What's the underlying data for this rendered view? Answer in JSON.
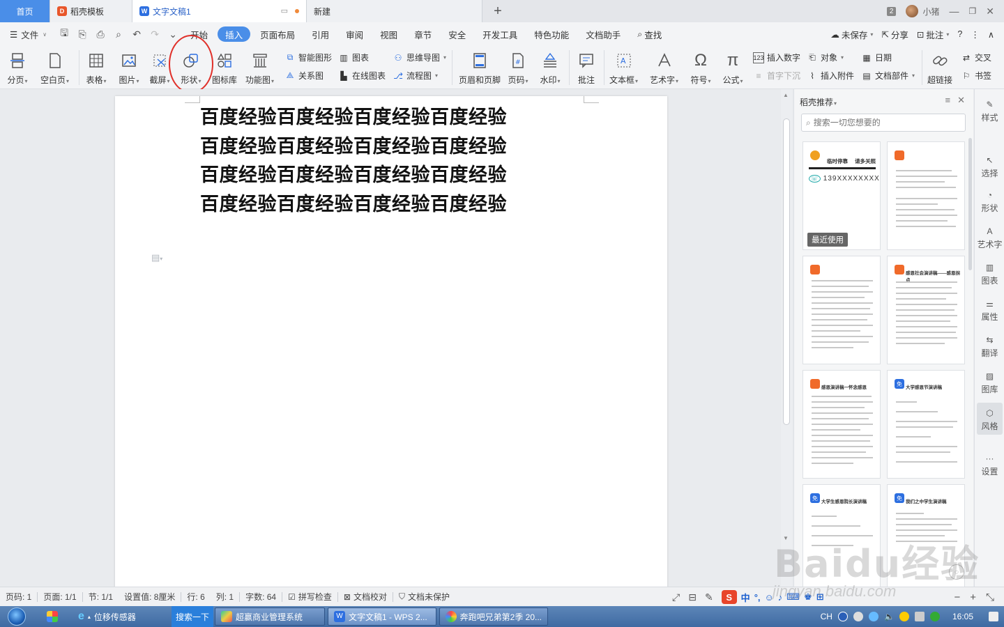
{
  "titlebar": {
    "tabs": [
      {
        "label": "首页"
      },
      {
        "label": "稻壳模板"
      },
      {
        "label": "文字文稿1"
      },
      {
        "label": "新建"
      }
    ],
    "page_number_badge": "2",
    "username": "小猪"
  },
  "menubar": {
    "file_label": "文件",
    "items": [
      "开始",
      "插入",
      "页面布局",
      "引用",
      "审阅",
      "视图",
      "章节",
      "安全",
      "开发工具",
      "特色功能",
      "文档助手"
    ],
    "active_item": "插入",
    "search_label": "查找",
    "unsaved_label": "未保存",
    "share_label": "分享",
    "comment_label": "批注"
  },
  "ribbon": {
    "page_break": "分页",
    "blank_page": "空白页",
    "table": "表格",
    "picture": "图片",
    "screenshot": "截屏",
    "shape": "形状",
    "icon_lib": "图标库",
    "function_chart": "功能图",
    "smart_art": "智能图形",
    "chart": "图表",
    "mind_map": "思维导图",
    "relation": "关系图",
    "online_chart": "在线图表",
    "flowchart": "流程图",
    "header_footer": "页眉和页脚",
    "page_num": "页码",
    "watermark": "水印",
    "comment": "批注",
    "textbox": "文本框",
    "word_art": "艺术字",
    "symbol": "符号",
    "formula": "公式",
    "insert_number": "插入数字",
    "object": "对象",
    "date": "日期",
    "drop_cap": "首字下沉",
    "attachment": "插入附件",
    "doc_parts": "文档部件",
    "hyperlink": "超链接",
    "cross_ref": "交叉",
    "bookmark": "书签"
  },
  "document": {
    "lines": [
      "百度经验百度经验百度经验百度经验",
      "百度经验百度经验百度经验百度经验",
      "百度经验百度经验百度经验百度经验",
      "百度经验百度经验百度经验百度经验"
    ]
  },
  "panel": {
    "title": "稻壳推荐",
    "search_placeholder": "搜索一切您想要的",
    "recent_label": "最近使用",
    "card1_title": "临时停靠",
    "card1_sub": "请多关照",
    "card1_phone": "139XXXXXXXX",
    "cards": [
      {
        "title": ""
      },
      {
        "title": "感恩社会演讲稿——感恩拐点"
      },
      {
        "title": "感恩演讲稿一怀念感恩"
      },
      {
        "title": "大学感恩节演讲稿"
      },
      {
        "title": "大学生感恩院长演讲稿"
      },
      {
        "title": "我们之中学生演讲稿"
      }
    ],
    "free_badge": "免"
  },
  "sidebar": [
    "样式",
    "选择",
    "形状",
    "艺术字",
    "图表",
    "属性",
    "翻译",
    "图库",
    "风格",
    "设置"
  ],
  "statusbar": {
    "page_code": "页码: 1",
    "pages": "页面: 1/1",
    "section": "节: 1/1",
    "setting": "设置值: 8厘米",
    "row": "行: 6",
    "col": "列: 1",
    "words": "字数: 64",
    "spell": "拼写检查",
    "proof": "文档校对",
    "protect": "文档未保护"
  },
  "taskbar": {
    "items": [
      "位移传感器",
      "超赢商业管理系统",
      "文字文稿1 - WPS 2...",
      "奔跑吧兄弟第2季 20..."
    ],
    "search_button": "搜索一下",
    "lang": "CH",
    "time": "16:05"
  },
  "ime": {
    "label": "中"
  },
  "colors": {
    "accent": "#4a8ee8",
    "highlight_circle": "#e0302a"
  }
}
